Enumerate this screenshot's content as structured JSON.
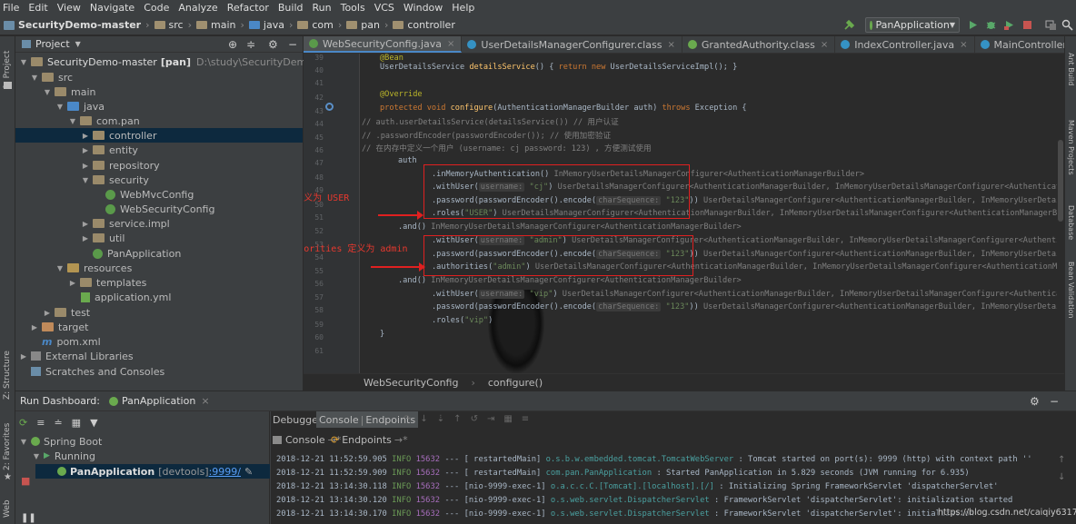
{
  "menu": [
    "File",
    "Edit",
    "View",
    "Navigate",
    "Code",
    "Analyze",
    "Refactor",
    "Build",
    "Run",
    "Tools",
    "VCS",
    "Window",
    "Help"
  ],
  "breadcrumb": [
    "SecurityDemo-master",
    "src",
    "main",
    "java",
    "com",
    "pan",
    "controller"
  ],
  "run_config": "PanApplication",
  "left_strip": {
    "project": "1: Project",
    "structure": "Z: Structure",
    "favorites": "2: Favorites",
    "web": "Web"
  },
  "right_strip": {
    "ant": "Ant Build",
    "maven": "Maven Projects",
    "database": "Database",
    "bean": "Bean Validation"
  },
  "project": {
    "title": "Project",
    "tree": [
      {
        "label": "SecurityDemo-master",
        "extra": "[pan]",
        "path": "D:\\study\\SecurityDemo-master"
      },
      {
        "label": "src"
      },
      {
        "label": "main"
      },
      {
        "label": "java"
      },
      {
        "label": "com.pan"
      },
      {
        "label": "controller"
      },
      {
        "label": "entity"
      },
      {
        "label": "repository"
      },
      {
        "label": "security"
      },
      {
        "label": "WebMvcConfig"
      },
      {
        "label": "WebSecurityConfig"
      },
      {
        "label": "service.impl"
      },
      {
        "label": "util"
      },
      {
        "label": "PanApplication"
      },
      {
        "label": "resources"
      },
      {
        "label": "templates"
      },
      {
        "label": "application.yml"
      },
      {
        "label": "test"
      },
      {
        "label": "target"
      },
      {
        "label": "pom.xml"
      },
      {
        "label": "External Libraries"
      },
      {
        "label": "Scratches and Consoles"
      }
    ]
  },
  "tabs": [
    "WebSecurityConfig.java",
    "UserDetailsManagerConfigurer.class",
    "GrantedAuthority.class",
    "IndexController.java",
    "MainController.java"
  ],
  "tabs_overflow": "≡5",
  "editor": {
    "line_numbers": [
      "39",
      "40",
      "41",
      "42",
      "43",
      "44",
      "45",
      "46",
      "47",
      "48",
      "49",
      "50",
      "51",
      "52",
      "53",
      "54",
      "55",
      "56",
      "57",
      "58",
      "59",
      "60",
      "61"
    ],
    "lines": {
      "l39": "@Bean",
      "l40_a": "UserDetailsService ",
      "l40_fn": "detailsService",
      "l40_b": "() { ",
      "l40_kw": "return new ",
      "l40_c": "UserDetailsServiceImpl(); }",
      "l42": "@Override",
      "l43_kw": "protected void ",
      "l43_fn": "configure",
      "l43_b": "(AuthenticationManagerBuilder auth) ",
      "l43_kw2": "throws ",
      "l43_c": "Exception {",
      "l44": "//        auth.userDetailsService(detailsService()) // 用户认证",
      "l45": "//                .passwordEncoder(passwordEncoder()); // 使用加密验证",
      "l46": "//        在内存中定义一个用户 (username: cj password: 123) , 方便测试使用",
      "l47": "auth",
      "l48_a": ".inMemoryAuthentication()",
      "l48_t": "InMemoryUserDetailsManagerConfigurer<AuthenticationManagerBuilder>",
      "l49_a": ".withUser(",
      "l49_h": "username:",
      "l49_s": "\"cj\"",
      "l49_b": ")",
      "l49_t": "UserDetailsManagerConfigurer<AuthenticationManagerBuilder, InMemoryUserDetailsManagerConfigurer<AuthenticationManagerB",
      "l50_a": ".password(passwordEncoder().encode(",
      "l50_h": "charSequence:",
      "l50_s": "\"123\"",
      "l50_b": "))",
      "l50_t": "UserDetailsManagerConfigurer<AuthenticationManagerBuilder, InMemoryUserDetailsManagerCo",
      "l51_a": ".roles(",
      "l51_s": "\"USER\"",
      "l51_b": ")",
      "l51_t": "UserDetailsManagerConfigurer<AuthenticationManagerBuilder, InMemoryUserDetailsManagerConfigurer<AuthenticationManagerBuilder>>.User",
      "l52_a": ".and()",
      "l52_t": "InMemoryUserDetailsManagerConfigurer<AuthenticationManagerBuilder>",
      "l53_a": ".withUser(",
      "l53_h": "username:",
      "l53_s": "\"admin\"",
      "l53_b": ")",
      "l53_t": "UserDetailsManagerConfigurer<AuthenticationManagerBuilder, InMemoryUserDetailsManagerConfigurer<Authentication",
      "l54_a": ".password(passwordEncoder().encode(",
      "l54_h": "charSequence:",
      "l54_s": "\"123\"",
      "l54_b": "))",
      "l54_t": "UserDetailsManagerConfigurer<AuthenticationManagerBuilder, InMemoryUserDetailsManagerCo",
      "l55_a": ".authorities(",
      "l55_s": "\"admin\"",
      "l55_b": ")",
      "l55_t": "UserDetailsManagerConfigurer<AuthenticationManagerBuilder, InMemoryUserDetailsManagerConfigurer<AuthenticationManagerBuilder>>",
      "l56_a": ".and()",
      "l56_t": "InMemoryUserDetailsManagerConfigurer<AuthenticationManagerBuilder>",
      "l57_a": ".withUser(",
      "l57_h": "username:",
      "l57_s": "\"vip\"",
      "l57_b": ")",
      "l57_t": "UserDetailsManagerConfigurer<AuthenticationManagerBuilder, InMemoryUserDetailsManagerConfigurer<AuthenticationManagerBu",
      "l58_a": ".password(passwordEncoder().encode(",
      "l58_h": "charSequence:",
      "l58_s": "\"123\"",
      "l58_b": "))",
      "l58_t": "UserDetailsManagerConfigurer<AuthenticationManagerBuilder, InMemoryUserDetailsManagerCo",
      "l59_a": ".roles(",
      "l59_s": "\"vip\"",
      "l59_b": ")",
      "l60": "}"
    },
    "annotations": {
      "cj": "cj的roles定义为 USER",
      "admin": "admin的 authorities 定义为 admin"
    },
    "breadcrumb": [
      "WebSecurityConfig",
      "configure()"
    ]
  },
  "run_dashboard": {
    "title": "Run Dashboard:",
    "app": "PanApplication",
    "tree": {
      "spring_boot": "Spring Boot",
      "running": "Running",
      "app": "PanApplication",
      "devtools": "[devtools]",
      "port": ":9999/"
    },
    "subtabs": [
      "Debugger",
      "Console",
      "Endpoints"
    ],
    "console_tabs": [
      "Console",
      "Endpoints"
    ],
    "logs": [
      {
        "ts": "2018-12-21 11:52:59.905",
        "lvl": "INFO",
        "pid": "15632",
        "sep": "---",
        "thr": "[  restartedMain]",
        "logger": "o.s.b.w.embedded.tomcat.TomcatWebServer",
        "msg": ": Tomcat started on port(s): 9999 (http) with context path ''"
      },
      {
        "ts": "2018-12-21 11:52:59.909",
        "lvl": "INFO",
        "pid": "15632",
        "sep": "---",
        "thr": "[  restartedMain]",
        "logger": "com.pan.PanApplication",
        "msg": ": Started PanApplication in 5.829 seconds (JVM running for 6.935)"
      },
      {
        "ts": "2018-12-21 13:14:30.118",
        "lvl": "INFO",
        "pid": "15632",
        "sep": "---",
        "thr": "[nio-9999-exec-1]",
        "logger": "o.a.c.c.C.[Tomcat].[localhost].[/]",
        "msg": ": Initializing Spring FrameworkServlet 'dispatcherServlet'"
      },
      {
        "ts": "2018-12-21 13:14:30.120",
        "lvl": "INFO",
        "pid": "15632",
        "sep": "---",
        "thr": "[nio-9999-exec-1]",
        "logger": "o.s.web.servlet.DispatcherServlet",
        "msg": ": FrameworkServlet 'dispatcherServlet': initialization started"
      },
      {
        "ts": "2018-12-21 13:14:30.170",
        "lvl": "INFO",
        "pid": "15632",
        "sep": "---",
        "thr": "[nio-9999-exec-1]",
        "logger": "o.s.web.servlet.DispatcherServlet",
        "msg": ": FrameworkServlet 'dispatcherServlet': initialization"
      }
    ],
    "watermark": "https://blog.csdn.net/caiqiy6317"
  }
}
